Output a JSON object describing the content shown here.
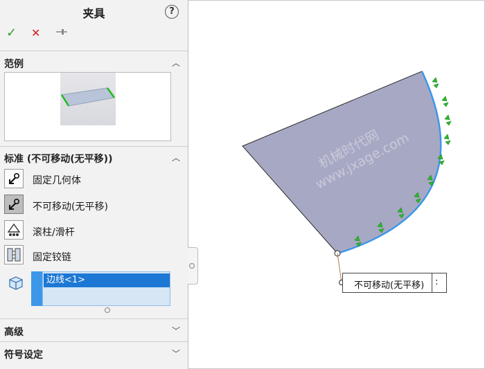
{
  "panel": {
    "title": "夹具",
    "help_icon": "?",
    "commands": {
      "ok": "✓",
      "cancel": "✕",
      "pin": "⊣"
    },
    "example_section": {
      "label": "范例"
    },
    "standard_section": {
      "label": "标准 (不可移动(无平移))",
      "options": [
        {
          "label": "固定几何体"
        },
        {
          "label": "不可移动(无平移)"
        },
        {
          "label": "滚柱/滑杆"
        },
        {
          "label": "固定铰链"
        }
      ]
    },
    "selection": {
      "items": [
        "边线<1>"
      ]
    },
    "advanced_section": {
      "label": "高级"
    },
    "symbol_section": {
      "label": "符号设定"
    }
  },
  "viewport": {
    "callout": {
      "text": "不可移动(无平移)",
      "suffix": ":"
    },
    "watermark": {
      "line1": "机械时代网",
      "line2": "www.jxage.com"
    }
  },
  "colors": {
    "accent": "#1c78d4",
    "face": "#a7a9c4",
    "edge_selected": "#3d97e8",
    "fixture_green": "#2eb82e"
  }
}
